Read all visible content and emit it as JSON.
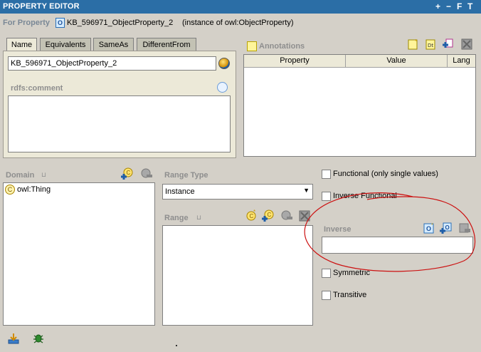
{
  "titlebar": {
    "title": "PROPERTY EDITOR",
    "controls": [
      "+",
      "−",
      "F",
      "T"
    ]
  },
  "header": {
    "for_label": "For Property",
    "property_name": "KB_596971_ObjectProperty_2",
    "instance_text": "(instance of owl:ObjectProperty)"
  },
  "tabs": [
    "Name",
    "Equivalents",
    "SameAs",
    "DifferentFrom"
  ],
  "name_tab": {
    "name_value": "KB_596971_ObjectProperty_2",
    "comment_label": "rdfs:comment",
    "comment_value": ""
  },
  "annotations": {
    "label": "Annotations",
    "columns": [
      "Property",
      "Value",
      "Lang"
    ]
  },
  "domain": {
    "label": "Domain",
    "items": [
      {
        "badge": "C",
        "text": "owl:Thing"
      }
    ]
  },
  "range_type": {
    "label": "Range Type",
    "selected": "Instance"
  },
  "range": {
    "label": "Range"
  },
  "characteristics": {
    "functional": "Functional (only single values)",
    "inverse_functional": "Inverse Functional",
    "symmetric": "Symmetric",
    "transitive": "Transitive"
  },
  "inverse": {
    "label": "Inverse",
    "value": ""
  },
  "colors": {
    "titlebar": "#2b6ea6",
    "background": "#d4d0c8",
    "annotation_circle": "#cc1111"
  }
}
